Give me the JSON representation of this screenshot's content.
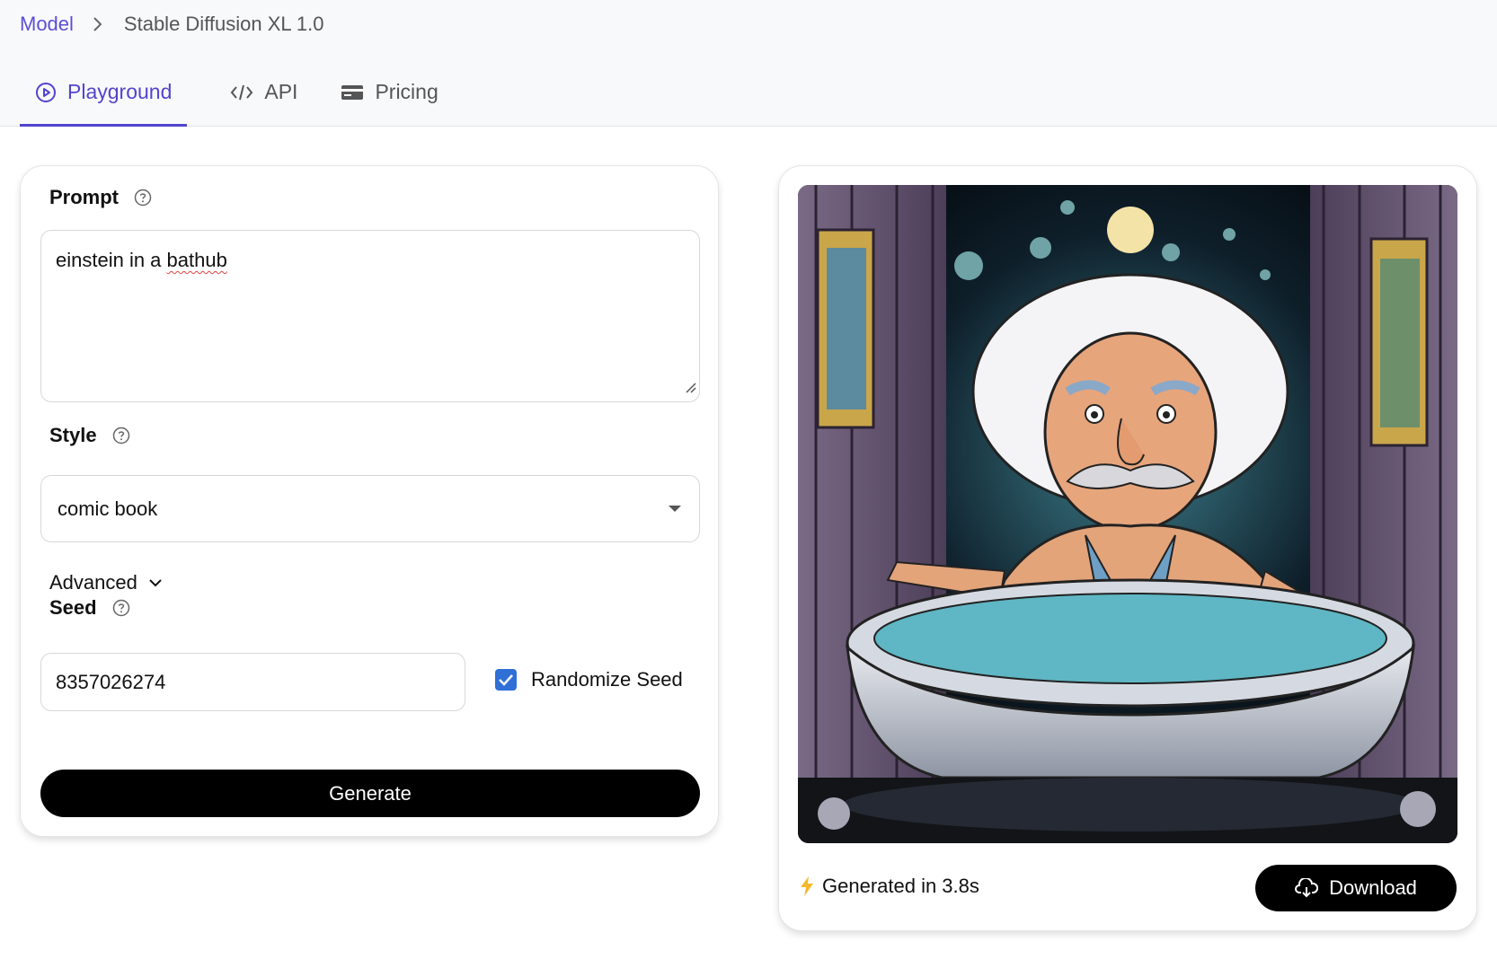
{
  "breadcrumb": {
    "root": "Model",
    "current": "Stable Diffusion XL 1.0"
  },
  "tabs": [
    {
      "label": "Playground",
      "icon": "play-circle-icon",
      "active": true
    },
    {
      "label": "API",
      "icon": "code-icon",
      "active": false
    },
    {
      "label": "Pricing",
      "icon": "credit-card-icon",
      "active": false
    }
  ],
  "form": {
    "prompt_label": "Prompt",
    "prompt_value_before": "einstein in a ",
    "prompt_value_misspelled": "bathub",
    "style_label": "Style",
    "style_value": "comic book",
    "advanced_label": "Advanced",
    "seed_label": "Seed",
    "seed_value": "8357026274",
    "randomize_label": "Randomize Seed",
    "randomize_checked": true,
    "generate_label": "Generate"
  },
  "result": {
    "generated_text": "Generated in 3.8s",
    "download_label": "Download"
  },
  "colors": {
    "accent": "#5145cd",
    "checkbox": "#2f6fd6",
    "button": "#000000"
  }
}
